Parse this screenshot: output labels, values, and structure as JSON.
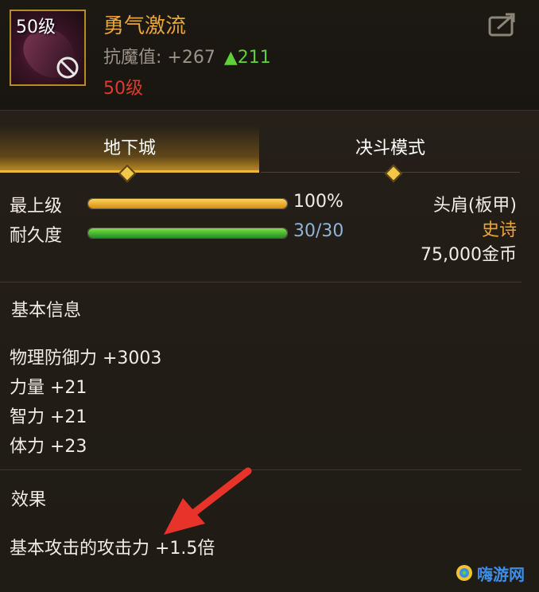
{
  "item": {
    "icon_level": "50级",
    "name": "勇气激流",
    "stat_label": "抗魔值:",
    "stat_value": "+267",
    "stat_increase": "▲211",
    "required_level": "50级"
  },
  "tabs": [
    {
      "label": "地下城",
      "active": true
    },
    {
      "label": "决斗模式",
      "active": false
    }
  ],
  "bars": [
    {
      "label": "最上级",
      "value_text": "100%",
      "fraction": 1.0
    },
    {
      "label": "耐久度",
      "value_text": "30/30",
      "fraction": 1.0
    }
  ],
  "meta": {
    "slot": "头肩(板甲)",
    "rarity": "史诗",
    "price": "75,000金币"
  },
  "basic_info": {
    "title": "基本信息",
    "attributes": [
      "物理防御力 +3003",
      "力量 +21",
      "智力 +21",
      "体力 +23"
    ]
  },
  "effect": {
    "title": "效果",
    "text": "基本攻击的攻击力 +1.5倍"
  },
  "watermark": "嗨游网",
  "colors": {
    "item_name": "#e9a53b",
    "required_level": "#e2392e",
    "rarity": "#e9a53b",
    "stat_increase": "#5fd03a",
    "durability_value": "#8fb4d8"
  },
  "icons": [
    "no-trade-icon",
    "share-icon",
    "arrow-annotation"
  ]
}
